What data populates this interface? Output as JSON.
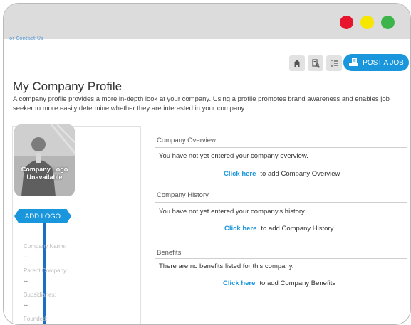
{
  "window": {
    "buttons": [
      "close",
      "minimize",
      "maximize"
    ],
    "colors": {
      "close": "#e8142e",
      "minimize": "#f6e600",
      "maximize": "#3bb54a"
    }
  },
  "breadcrumb": {
    "text": "or Contact Us"
  },
  "toolbar": {
    "icons": [
      "home-icon",
      "search-document-icon",
      "list-icon"
    ],
    "post_job_label": "POST A JOB",
    "accent": "#1a96dc"
  },
  "page": {
    "title": "My Company Profile",
    "description": "A company profile provides a more in-depth look at your company. Using a profile promotes brand awareness and enables job seeker to more easily determine whether they are interested in your company."
  },
  "sidebar": {
    "logo_placeholder_line1": "Company Logo",
    "logo_placeholder_line2": "Unavailable",
    "add_logo_label": "ADD LOGO",
    "fields": [
      {
        "label": "Company Name:",
        "value": "--"
      },
      {
        "label": "Parent Company:",
        "value": "--"
      },
      {
        "label": "Subsidiaries:",
        "value": "--"
      },
      {
        "label": "Founded:",
        "value": ""
      }
    ]
  },
  "sections": [
    {
      "title": "Company Overview",
      "body": "You have not yet entered your company overview.",
      "link": "Click here",
      "action": "to add Company Overview"
    },
    {
      "title": "Company History",
      "body": "You have not yet entered your company's history.",
      "link": "Click here",
      "action": "to add Company History"
    },
    {
      "title": "Benefits",
      "body": "There are no benefits listed for this company.",
      "link": "Click here",
      "action": "to add Company Benefits"
    }
  ]
}
